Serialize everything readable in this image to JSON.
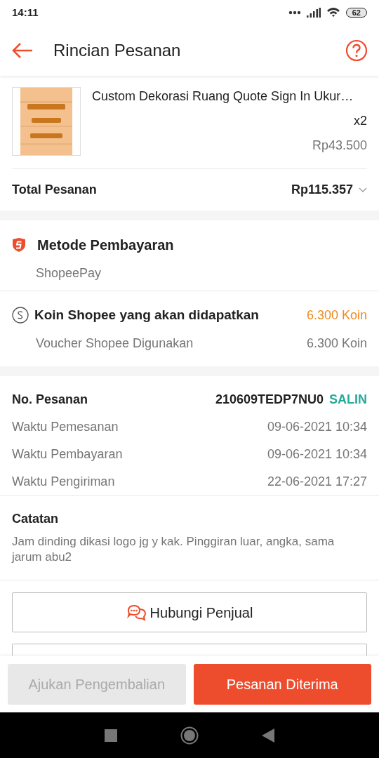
{
  "status_bar": {
    "time": "14:11",
    "battery": "62"
  },
  "header": {
    "title": "Rincian Pesanan"
  },
  "product": {
    "name": "Custom Dekorasi Ruang Quote Sign In Ukur…",
    "quantity": "x2",
    "price": "Rp43.500"
  },
  "total": {
    "label": "Total Pesanan",
    "value": "Rp115.357"
  },
  "payment": {
    "title": "Metode Pembayaran",
    "method": "ShopeePay"
  },
  "coins": {
    "title": "Koin Shopee yang akan didapatkan",
    "amount": "6.300 Koin",
    "voucher_label": "Voucher Shopee Digunakan",
    "voucher_amount": "6.300 Koin"
  },
  "order": {
    "number_label": "No. Pesanan",
    "number": "210609TEDP7NU0",
    "copy_label": "SALIN",
    "rows": [
      {
        "label": "Waktu Pemesanan",
        "value": "09-06-2021 10:34"
      },
      {
        "label": "Waktu Pembayaran",
        "value": "09-06-2021 10:34"
      },
      {
        "label": "Waktu Pengiriman",
        "value": "22-06-2021 17:27"
      }
    ]
  },
  "notes": {
    "title": "Catatan",
    "text": "Jam dinding dikasi logo jg y kak. Pinggiran luar, angka, sama jarum abu2"
  },
  "contact_button": {
    "label": "Hubungi Penjual"
  },
  "actions": [
    {
      "label": "Ajukan Pengembalian",
      "disabled": true
    },
    {
      "label": "Pesanan Diterima",
      "disabled": false
    }
  ]
}
